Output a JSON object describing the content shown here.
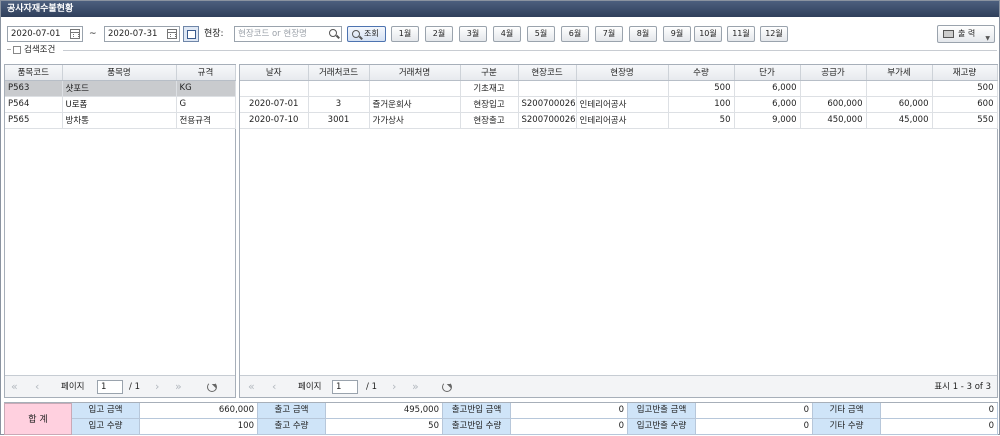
{
  "window": {
    "title": "공사자재수불현황"
  },
  "filters": {
    "date_from": "2020-07-01",
    "tilde": "~",
    "date_to": "2020-07-31",
    "site_label": "현장:",
    "site_placeholder": "현장코드 or 현장명",
    "search_label": "조회",
    "months": [
      "1월",
      "2월",
      "3월",
      "4월",
      "5월",
      "6월",
      "7월",
      "8월",
      "9월",
      "10월",
      "11월",
      "12월"
    ],
    "print_label": "출 력",
    "condition_label": "검색조건"
  },
  "left_grid": {
    "headers": [
      "품목코드",
      "품목명",
      "규격"
    ],
    "rows": [
      [
        "P563",
        "샷포드",
        "KG"
      ],
      [
        "P564",
        "U로폼",
        "G"
      ],
      [
        "P565",
        "방차통",
        "전용규격"
      ]
    ],
    "selected_index": 0
  },
  "right_grid": {
    "headers": [
      "날자",
      "거래처코드",
      "거래처명",
      "구분",
      "현장코드",
      "현장명",
      "수량",
      "단가",
      "공급가",
      "부가세",
      "재고량"
    ],
    "rows": [
      [
        "",
        "",
        "",
        "기초재고",
        "",
        "",
        "500",
        "6,000",
        "",
        "",
        "500"
      ],
      [
        "2020-07-01",
        "3",
        "즐거운회사",
        "현장입고",
        "S200700026",
        "인테리어공사",
        "100",
        "6,000",
        "600,000",
        "60,000",
        "600"
      ],
      [
        "2020-07-10",
        "3001",
        "가가상사",
        "현장출고",
        "S200700026",
        "인테리어공사",
        "50",
        "9,000",
        "450,000",
        "45,000",
        "550"
      ]
    ]
  },
  "pager_left": {
    "page_label": "페이지",
    "page_value": "1",
    "total": "/ 1"
  },
  "pager_right": {
    "page_label": "페이지",
    "page_value": "1",
    "total": "/ 1",
    "status": "표시 1 - 3 of 3"
  },
  "summary": {
    "title": "합 계",
    "row1": [
      {
        "label": "입고 금액",
        "value": "660,000"
      },
      {
        "label": "출고 금액",
        "value": "495,000"
      },
      {
        "label": "출고반입 금액",
        "value": "0"
      },
      {
        "label": "입고반출 금액",
        "value": "0"
      },
      {
        "label": "기타 금액",
        "value": "0"
      }
    ],
    "row2": [
      {
        "label": "입고 수량",
        "value": "100"
      },
      {
        "label": "출고 수량",
        "value": "50"
      },
      {
        "label": "출고반입 수량",
        "value": "0"
      },
      {
        "label": "입고반출 수량",
        "value": "0"
      },
      {
        "label": "기타 수량",
        "value": "0"
      }
    ]
  }
}
